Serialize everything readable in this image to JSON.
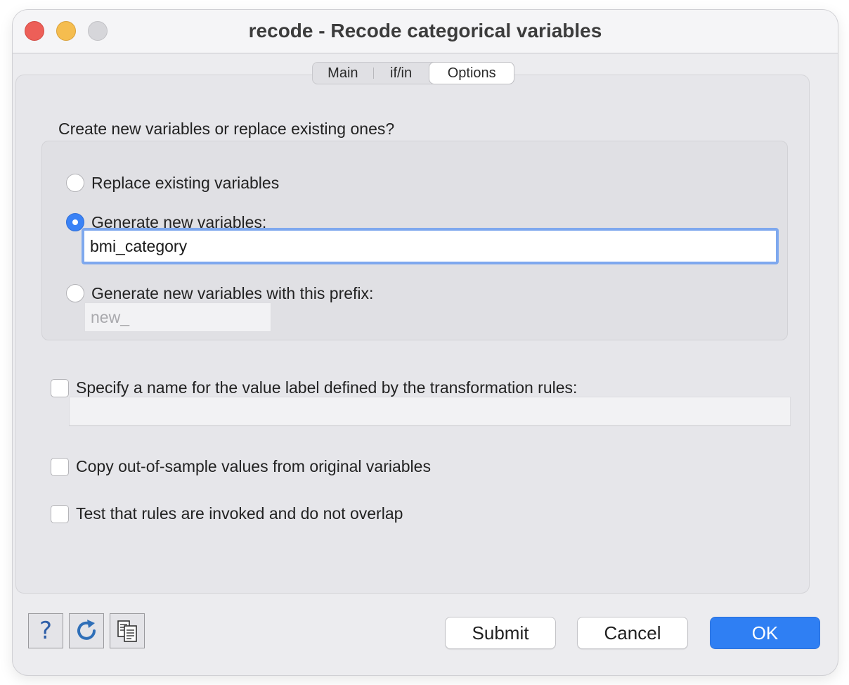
{
  "window": {
    "title": "recode - Recode categorical variables"
  },
  "tabs": [
    {
      "label": "Main",
      "selected": false
    },
    {
      "label": "if/in",
      "selected": false
    },
    {
      "label": "Options",
      "selected": true
    }
  ],
  "options": {
    "section_label": "Create new variables or replace existing ones?",
    "replace_label": "Replace existing variables",
    "generate_label": "Generate new variables:",
    "generate_value": "bmi_category",
    "prefix_label": "Generate new variables with this prefix:",
    "prefix_value": "new_",
    "value_label_name_label": "Specify a name for the value label defined by the transformation rules:",
    "value_label_name_value": "",
    "copy_label": "Copy out-of-sample values from original variables",
    "test_label": "Test that rules are invoked and do not overlap"
  },
  "footer": {
    "help_glyph": "?",
    "submit_label": "Submit",
    "cancel_label": "Cancel",
    "ok_label": "OK"
  },
  "colors": {
    "accent": "#2f7ff3",
    "close": "#ed5f58",
    "minimize": "#f5bd4f",
    "zoom_disabled": "#d6d6da"
  }
}
